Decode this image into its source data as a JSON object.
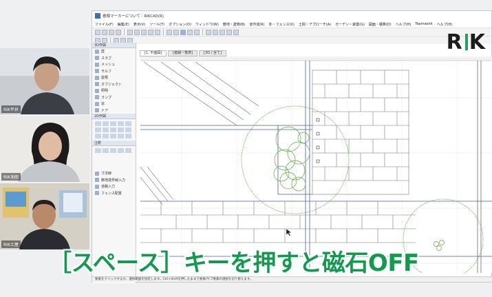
{
  "window": {
    "title": "巻頭マーカーについて - RIKCAD(R)"
  },
  "menu": [
    "ファイル(F)",
    "編集(E)",
    "表示(V)",
    "ツール(T)",
    "オプション(O)",
    "ウィンドウ(W)",
    "敷地・建物(B)",
    "道作成(R)",
    "外・フェンス(X)",
    "土間・アプローチ(A)",
    "ガーデン・装置(G)",
    "図面・積算(D)",
    "ヘルプ(H)",
    "Teamwork",
    "ヘルプ(H)"
  ],
  "tabs": [
    "[1. 平面図]",
    "[植栽一覧表]",
    "[3D / 全て]"
  ],
  "palette": {
    "section1": "3D作図",
    "items": [
      "壁",
      "スラブ",
      "メッシュ",
      "モルフ",
      "屋根",
      "オブジェクト",
      "照明",
      "ランプ",
      "窓",
      "ドア"
    ],
    "section2": "2D作図",
    "section3": "注釈",
    "items2": [
      "寸法線",
      "敷地境界線入力",
      "道路入力",
      "フェンス配置"
    ]
  },
  "participants": [
    "RIK平井",
    "RIK池田",
    "RIK土屋"
  ],
  "status_text": "要素をクリックするか、選択範囲を指定します。Ctrl+Shiftを押したままで要素/サブ要素の選択を切り替えます。",
  "logo": "RIK",
  "caption": "［スペース］キーを押すと磁石OFF",
  "colors": {
    "caption_green": "#129a4e",
    "logo_accent": "#25a060",
    "plant_green": "#5aa83c",
    "line_blue": "#4a5ea8"
  }
}
